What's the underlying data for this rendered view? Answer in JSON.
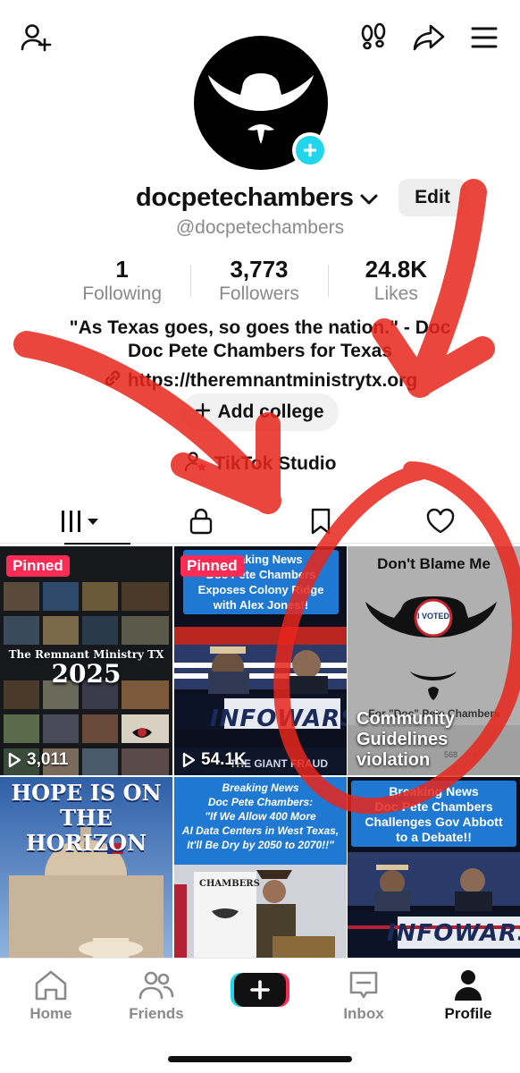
{
  "profile": {
    "username": "docpetechambers",
    "handle": "@docpetechambers",
    "edit_label": "Edit",
    "stats": [
      {
        "value": "1",
        "label": "Following"
      },
      {
        "value": "3,773",
        "label": "Followers"
      },
      {
        "value": "24.8K",
        "label": "Likes"
      }
    ],
    "bio_line1": "\"As Texas goes, so goes the nation.\" - Doc",
    "bio_line2": "Doc Pete Chambers for Texas",
    "link": "https://theremnantministrytx.org",
    "add_college_label": "Add college",
    "studio_label": "TikTok Studio"
  },
  "icons": {
    "add_friend": "add-friend-icon",
    "footprints": "footprints-icon",
    "share": "share-icon",
    "menu": "menu-icon",
    "link": "link-icon",
    "studio": "studio-icon"
  },
  "tabs": [
    {
      "name": "videos",
      "icon": "grid-icon"
    },
    {
      "name": "private",
      "icon": "lock-icon"
    },
    {
      "name": "saved",
      "icon": "bookmark-icon"
    },
    {
      "name": "liked",
      "icon": "heart-icon"
    }
  ],
  "videos": [
    {
      "pinned": "Pinned",
      "title_a": "The Remnant Ministry TX",
      "title_b": "2025",
      "views": "3,011"
    },
    {
      "pinned": "Pinned",
      "banner_a": "Breaking News",
      "banner_b": "Doc Pete Chambers",
      "banner_c": "Exposes Colony Ridge",
      "banner_d": "with Alex Jones!!",
      "views": "54.1K",
      "ticker": "INFOWARS",
      "lower_third": "THE GIANT FRAUD"
    },
    {
      "header": "Don't Blame Me",
      "button_text": "I VOTED",
      "credit": "For \"Doc\" Pete Chambers",
      "violation_1": "Community",
      "violation_2": "Guidelines",
      "violation_3": "violation",
      "count_a": "568",
      "count_b": "6"
    },
    {
      "headline_1": "HOPE IS ON",
      "headline_2": "THE HORIZON"
    },
    {
      "b1": "Breaking News",
      "b2": "Doc Pete Chambers:",
      "b3": "\"If We Allow 400 More",
      "b4": "AI Data Centers in West Texas,",
      "b5": "It'll Be Dry by 2050 to 2070!!\"",
      "sign": "CHAMBERS"
    },
    {
      "b1": "Breaking News",
      "b2": "Doc Pete Chambers",
      "b3": "Challenges Gov Abbott",
      "b4": "to a Debate!!",
      "ticker": "INFOWARS"
    }
  ],
  "nav": [
    {
      "label": "Home",
      "icon": "home-icon"
    },
    {
      "label": "Friends",
      "icon": "friends-icon"
    },
    {
      "label": "",
      "icon": "create-plus-icon"
    },
    {
      "label": "Inbox",
      "icon": "inbox-icon"
    },
    {
      "label": "Profile",
      "icon": "profile-icon"
    }
  ],
  "colors": {
    "accent_pink": "#fe2c55",
    "accent_cyan": "#20d5ec",
    "annotation_red": "#e8261c"
  }
}
